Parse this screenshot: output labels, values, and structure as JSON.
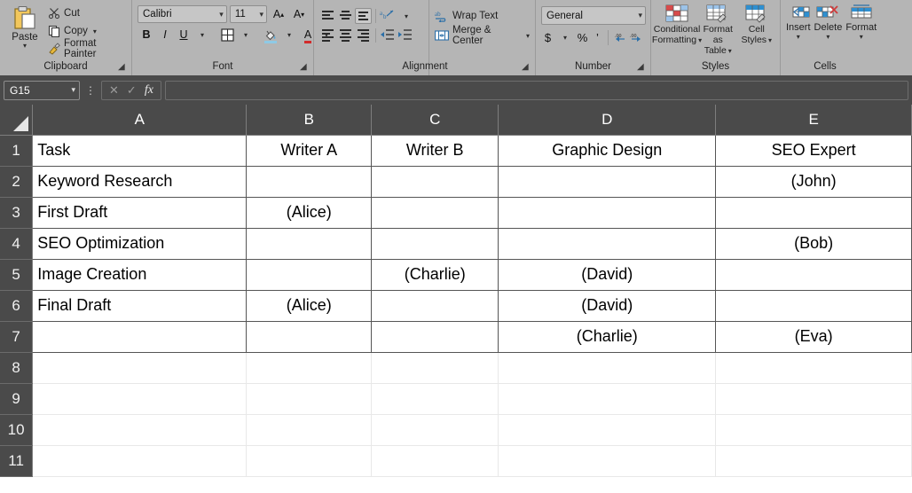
{
  "ribbon": {
    "clipboard": {
      "group_label": "Clipboard",
      "paste_label": "Paste",
      "items": [
        {
          "label": "Cut",
          "icon": "scissors-icon",
          "has_caret": false
        },
        {
          "label": "Copy",
          "icon": "copy-icon",
          "has_caret": true
        },
        {
          "label": "Format Painter",
          "icon": "paintbrush-icon",
          "has_caret": false
        }
      ]
    },
    "font": {
      "group_label": "Font",
      "font_name": "Calibri",
      "font_size": "11",
      "grow_font": "A",
      "shrink_font": "A",
      "bold": "B",
      "italic": "I",
      "underline": "U",
      "borders_icon": "borders-icon",
      "fill_color": "A",
      "font_color": "A"
    },
    "alignment": {
      "group_label": "Alignment",
      "top_align": "top-align-icon",
      "middle_align": "middle-align-icon",
      "bottom_align": "bottom-align-icon",
      "orientation": "orientation-icon",
      "align_left": "align-left-icon",
      "align_center": "align-center-icon",
      "align_right": "align-right-icon",
      "decrease_indent": "decrease-indent-icon",
      "increase_indent": "increase-indent-icon",
      "wrap_text": "Wrap Text",
      "merge_center": "Merge & Center"
    },
    "number": {
      "group_label": "Number",
      "format": "General",
      "accounting": "$",
      "percent": "%",
      "comma": "’",
      "increase_decimal": "increase-decimal-icon",
      "decrease_decimal": "decrease-decimal-icon"
    },
    "styles": {
      "group_label": "Styles",
      "conditional_formatting_l1": "Conditional",
      "conditional_formatting_l2": "Formatting",
      "format_as_table_l1": "Format as",
      "format_as_table_l2": "Table",
      "cell_styles_l1": "Cell",
      "cell_styles_l2": "Styles"
    },
    "cells": {
      "group_label": "Cells",
      "insert": "Insert",
      "delete": "Delete",
      "format": "Format"
    }
  },
  "formula_bar": {
    "name_box": "G15",
    "cancel_icon": "cancel-icon",
    "enter_icon": "confirm-check-icon",
    "function_icon": "fx",
    "formula_value": "",
    "formula_placeholder": ""
  },
  "sheet": {
    "column_headers": [
      "A",
      "B",
      "C",
      "D",
      "E"
    ],
    "row_numbers": [
      "1",
      "2",
      "3",
      "4",
      "5",
      "6",
      "7",
      "8",
      "9",
      "10",
      "11"
    ],
    "rows": [
      {
        "num": "1",
        "cells": [
          {
            "v": "Task",
            "fill": "f-head"
          },
          {
            "v": "Writer A",
            "fill": "f-head"
          },
          {
            "v": "Writer B",
            "fill": "f-head"
          },
          {
            "v": "Graphic Design",
            "fill": "f-head"
          },
          {
            "v": "SEO Expert",
            "fill": "f-head"
          }
        ]
      },
      {
        "num": "2",
        "cells": [
          {
            "v": "Keyword Research",
            "fill": ""
          },
          {
            "v": "",
            "fill": ""
          },
          {
            "v": "",
            "fill": ""
          },
          {
            "v": "",
            "fill": ""
          },
          {
            "v": "(John)",
            "fill": "f-blue-d"
          }
        ]
      },
      {
        "num": "3",
        "cells": [
          {
            "v": "First Draft",
            "fill": ""
          },
          {
            "v": "(Alice)",
            "fill": "f-yellow"
          },
          {
            "v": "",
            "fill": ""
          },
          {
            "v": "",
            "fill": ""
          },
          {
            "v": "",
            "fill": ""
          }
        ]
      },
      {
        "num": "4",
        "cells": [
          {
            "v": "SEO Optimization",
            "fill": ""
          },
          {
            "v": "",
            "fill": ""
          },
          {
            "v": "",
            "fill": ""
          },
          {
            "v": "",
            "fill": ""
          },
          {
            "v": "(Bob)",
            "fill": "f-blue-l"
          }
        ]
      },
      {
        "num": "5",
        "cells": [
          {
            "v": "Image Creation",
            "fill": ""
          },
          {
            "v": "",
            "fill": ""
          },
          {
            "v": "(Charlie)",
            "fill": "f-green"
          },
          {
            "v": "(David)",
            "fill": "f-orange"
          },
          {
            "v": "",
            "fill": ""
          }
        ]
      },
      {
        "num": "6",
        "cells": [
          {
            "v": "Final Draft",
            "fill": ""
          },
          {
            "v": "(Alice)",
            "fill": "f-yellow"
          },
          {
            "v": "",
            "fill": ""
          },
          {
            "v": "(David)",
            "fill": "f-orange"
          },
          {
            "v": "",
            "fill": ""
          }
        ]
      },
      {
        "num": "7",
        "cells": [
          {
            "v": "",
            "fill": ""
          },
          {
            "v": "",
            "fill": ""
          },
          {
            "v": "",
            "fill": ""
          },
          {
            "v": "(Charlie)",
            "fill": "f-green"
          },
          {
            "v": "(Eva)",
            "fill": "f-blue-m"
          }
        ]
      }
    ],
    "empty_rows": [
      "8",
      "9",
      "10",
      "11"
    ]
  }
}
